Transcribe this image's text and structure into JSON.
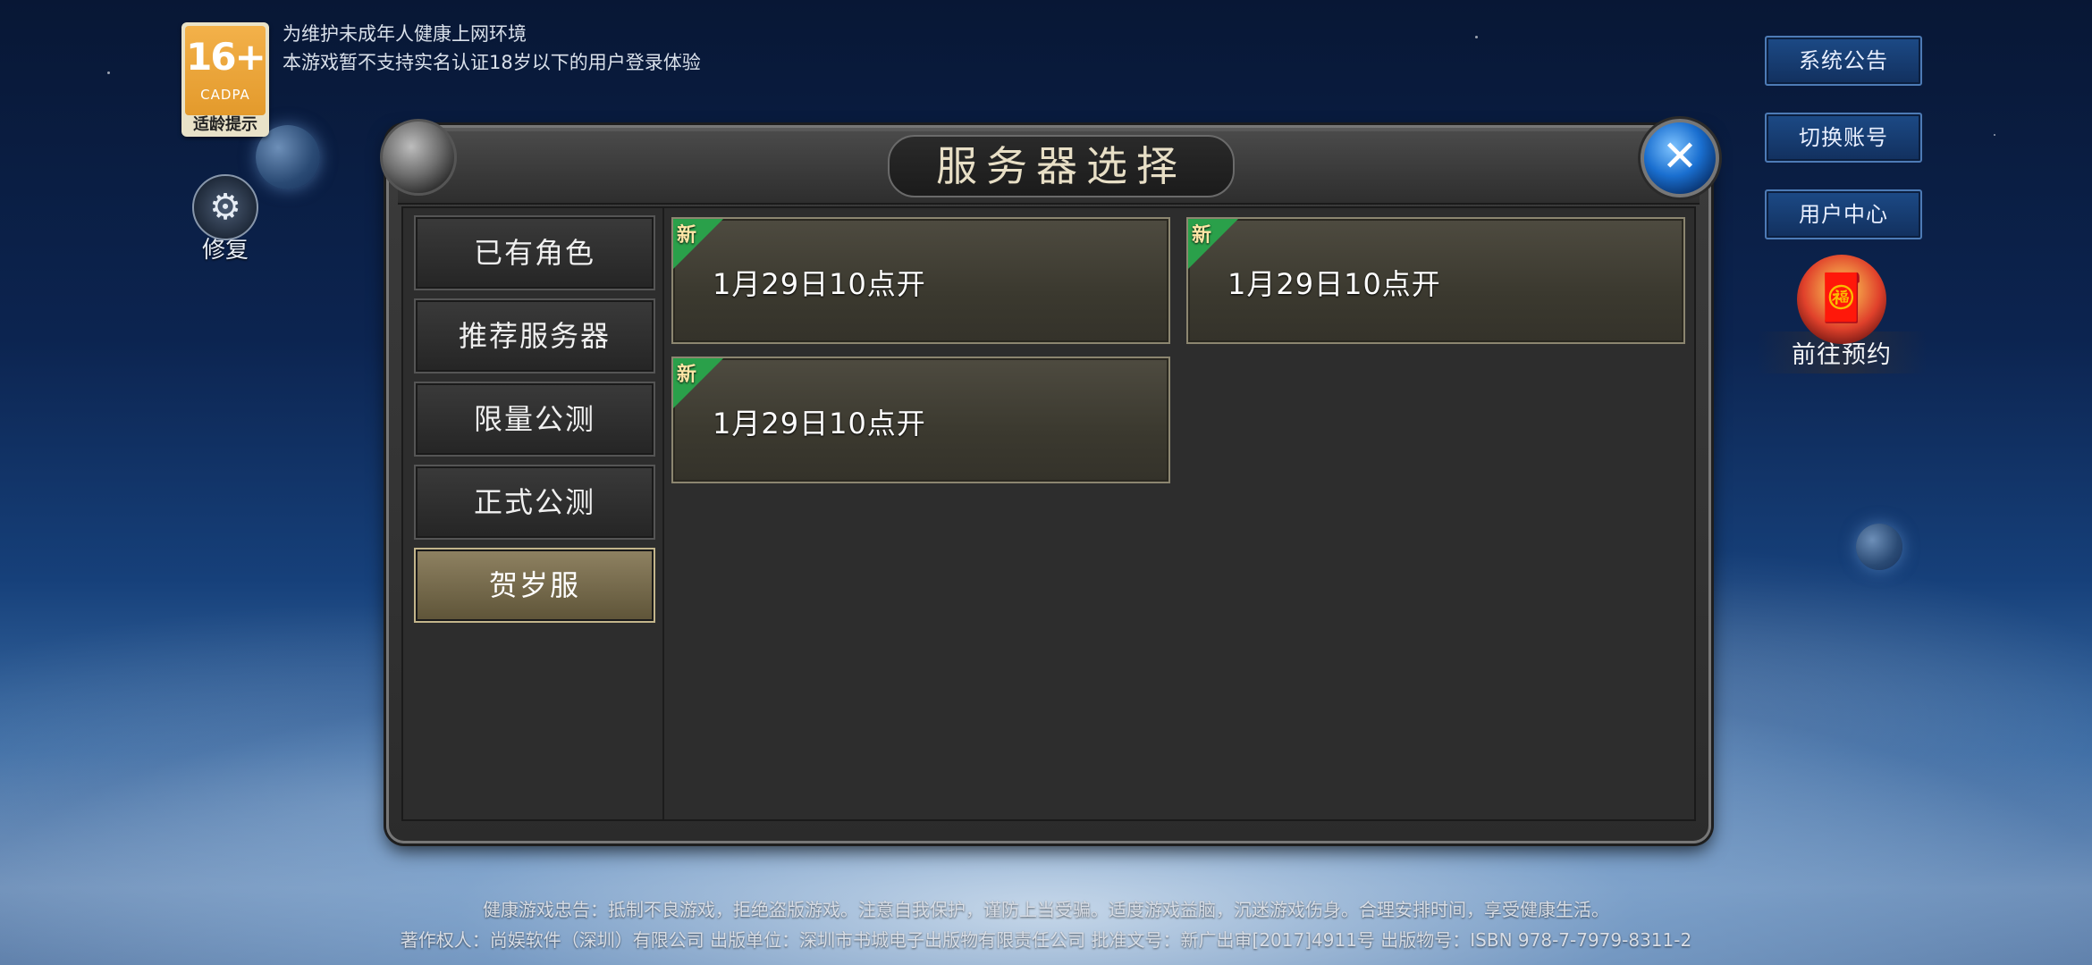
{
  "age_badge": {
    "rating": "16+",
    "org": "CADPA",
    "hint": "适龄提示"
  },
  "notice": {
    "line1": "为维护未成年人健康上网环境",
    "line2": "本游戏暂不支持实名认证18岁以下的用户登录体验"
  },
  "repair": {
    "icon": "wrench-gear-icon",
    "label": "修复"
  },
  "side_buttons": {
    "announcement": "系统公告",
    "switch_account": "切换账号",
    "user_center": "用户中心"
  },
  "reserve": {
    "icon": "gift-icon",
    "label": "前往预约"
  },
  "panel": {
    "title": "服务器选择",
    "close_icon": "close-icon"
  },
  "tabs": [
    {
      "label": "已有角色",
      "active": false
    },
    {
      "label": "推荐服务器",
      "active": false
    },
    {
      "label": "限量公测",
      "active": false
    },
    {
      "label": "正式公测",
      "active": false
    },
    {
      "label": "贺岁服",
      "active": true
    }
  ],
  "servers": [
    {
      "badge": "新",
      "name": "1月29日10点开"
    },
    {
      "badge": "新",
      "name": "1月29日10点开"
    },
    {
      "badge": "新",
      "name": "1月29日10点开"
    }
  ],
  "footer": {
    "line1": "健康游戏忠告：抵制不良游戏，拒绝盗版游戏。注意自我保护，谨防上当受骗。适度游戏益脑，沉迷游戏伤身。合理安排时间，享受健康生活。",
    "line2": "著作权人：尚娱软件（深圳）有限公司 出版单位：深圳市书城电子出版物有限责任公司 批准文号：新广出审[2017]4911号 出版物号：ISBN 978-7-7979-8311-2"
  },
  "colors": {
    "active_tab": "#8f8262",
    "new_ribbon": "#2aa04a",
    "side_button": "#1c4a86",
    "close_button": "#1a6fd0"
  }
}
